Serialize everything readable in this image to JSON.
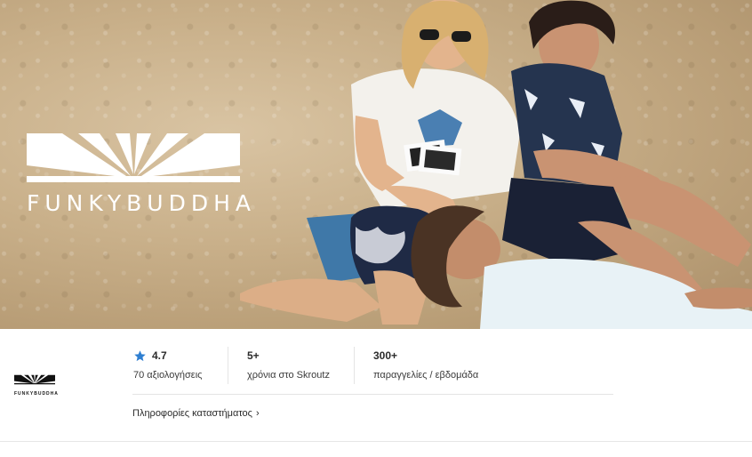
{
  "brand": {
    "name": "FUNKYBUDDHA"
  },
  "stats": {
    "rating": {
      "value": "4.7",
      "label": "70 αξιολογήσεις"
    },
    "years": {
      "value": "5+",
      "label": "χρόνια στο Skroutz"
    },
    "orders": {
      "value": "300+",
      "label": "παραγγελίες / εβδομάδα"
    }
  },
  "store_info": {
    "label": "Πληροφορίες καταστήματος",
    "chevron": "›"
  },
  "colors": {
    "star": "#2f7fd1",
    "text": "#2b2b2b",
    "divider": "#e4e4e4"
  },
  "icons": {
    "rating": "star-icon",
    "store_info": "chevron-right-icon"
  }
}
